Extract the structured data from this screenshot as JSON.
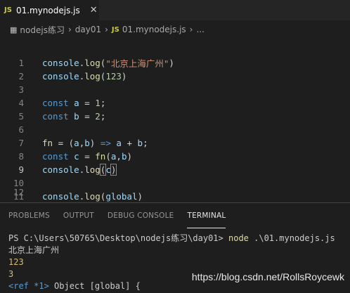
{
  "tab": {
    "badge": "JS",
    "filename": "01.mynodejs.js",
    "close": "✕"
  },
  "breadcrumb": {
    "icon": "folder-icon",
    "items": [
      "nodejs练习",
      "day01",
      "01.mynodejs.js",
      "..."
    ],
    "badge": "JS"
  },
  "editor": {
    "lines": [
      {
        "n": "1"
      },
      {
        "n": "2"
      },
      {
        "n": "3"
      },
      {
        "n": "4"
      },
      {
        "n": "5"
      },
      {
        "n": "6"
      },
      {
        "n": "7"
      },
      {
        "n": "8"
      },
      {
        "n": "9"
      },
      {
        "n": "10"
      },
      {
        "n": "11"
      },
      {
        "n": "12"
      }
    ],
    "code": {
      "l1_obj": "console",
      "l1_dot": ".",
      "l1_fn": "log",
      "l1_open": "(",
      "l1_str": "\"北京上海广州\"",
      "l1_close": ")",
      "l2_obj": "console",
      "l2_dot": ".",
      "l2_fn": "log",
      "l2_open": "(",
      "l2_num": "123",
      "l2_close": ")",
      "l4_kw": "const",
      "l4_var": "a",
      "l4_eq": " = ",
      "l4_num": "1",
      "l4_semi": ";",
      "l5_kw": "const",
      "l5_var": "b",
      "l5_eq": " = ",
      "l5_num": "2",
      "l5_semi": ";",
      "l7_fn": "fn",
      "l7_rest1": " = (",
      "l7_a": "a",
      "l7_comma": ",",
      "l7_b": "b",
      "l7_rest2": ") ",
      "l7_arrow": "=>",
      "l7_a2": " a",
      "l7_plus": " + ",
      "l7_b2": "b",
      "l7_semi": ";",
      "l8_kw": "const",
      "l8_var": "c",
      "l8_eq": " = ",
      "l8_fn": "fn",
      "l8_open": "(",
      "l8_a": "a",
      "l8_comma": ",",
      "l8_b": "b",
      "l8_close": ")",
      "l9_obj": "console",
      "l9_dot": ".",
      "l9_fn": "log",
      "l9_open": "(",
      "l9_var": "c",
      "l9_close": ")",
      "l11_obj": "console",
      "l11_dot": ".",
      "l11_fn": "log",
      "l11_open": "(",
      "l11_var": "global",
      "l11_close": ")"
    }
  },
  "panel": {
    "tabs": [
      "PROBLEMS",
      "OUTPUT",
      "DEBUG CONSOLE",
      "TERMINAL"
    ],
    "active_tab": "TERMINAL"
  },
  "terminal": {
    "prompt": "PS C:\\Users\\50765\\Desktop\\nodejs练习\\day01> ",
    "cmd": "node",
    "args": " .\\01.mynodejs.js",
    "out1": "北京上海广州",
    "out2": "123",
    "out3": "3",
    "out4_ref": "<ref *1>",
    "out4_rest": " Object [global] {"
  },
  "watermark": "https://blog.csdn.net/RollsRoycewk",
  "colors": {
    "background": "#1e1e1e",
    "tabbar": "#252526",
    "keyword": "#569cd6",
    "function": "#dcdcaa",
    "variable": "#9cdcfe",
    "string": "#ce9178",
    "number": "#b5cea8"
  }
}
